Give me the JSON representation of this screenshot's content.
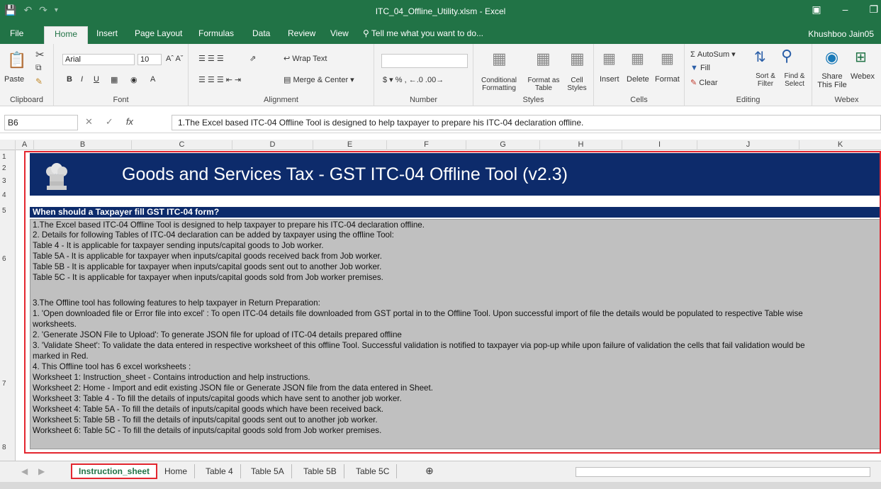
{
  "window": {
    "title": "ITC_04_Offline_Utility.xlsm - Excel",
    "user": "Khushboo Jain05",
    "qat_icons": [
      "save-icon",
      "undo-icon",
      "redo-icon",
      "customize-icon"
    ]
  },
  "ribbon_tabs": [
    "File",
    "Home",
    "Insert",
    "Page Layout",
    "Formulas",
    "Data",
    "Review",
    "View"
  ],
  "tell_me": "Tell me what you want to do...",
  "ribbon": {
    "clipboard": {
      "paste": "Paste",
      "label": "Clipboard"
    },
    "font": {
      "name": "Arial",
      "size": "10",
      "label": "Font"
    },
    "alignment": {
      "wrap": "Wrap Text",
      "merge": "Merge & Center",
      "label": "Alignment"
    },
    "number": {
      "format": "",
      "label": "Number"
    },
    "styles": {
      "conditional": "Conditional Formatting",
      "format_table": "Format as Table",
      "cell_styles": "Cell Styles",
      "label": "Styles"
    },
    "cells": {
      "insert": "Insert",
      "delete": "Delete",
      "format": "Format",
      "label": "Cells"
    },
    "editing": {
      "autosum": "AutoSum",
      "fill": "Fill",
      "clear": "Clear",
      "sort": "Sort & Filter",
      "find": "Find & Select",
      "label": "Editing"
    },
    "webex": {
      "share": "Share This File",
      "webex": "Webex",
      "label": "Webex"
    }
  },
  "formula_bar": {
    "cell_ref": "B6",
    "fx": "fx",
    "content": "1.The Excel based ITC-04 Offline Tool is designed to help taxpayer to prepare his ITC-04 declaration offline."
  },
  "columns": [
    "A",
    "B",
    "C",
    "D",
    "E",
    "F",
    "G",
    "H",
    "I",
    "J",
    "K"
  ],
  "rows": [
    "1",
    "2",
    "3",
    "4",
    "5",
    "6",
    "7",
    "8"
  ],
  "sheet": {
    "banner_title": "Goods and Services Tax - GST ITC-04 Offline Tool (v2.3)",
    "question": "When should a Taxpayer  fill GST ITC-04 form?",
    "lines": [
      "1.The Excel based ITC-04 Offline Tool is designed to help taxpayer to prepare his ITC-04 declaration offline.",
      "2. Details for following Tables of ITC-04 declaration can be added by taxpayer using the offline Tool:",
      "    Table 4 - It is applicable for taxpayer sending inputs/capital goods to Job worker.",
      "    Table 5A - It is applicable for taxpayer when inputs/capital goods received back from Job worker.",
      "    Table 5B - It is applicable for taxpayer when inputs/capital goods sent out to another Job worker.",
      "    Table 5C - It is applicable for taxpayer when inputs/capital goods sold from Job worker premises.",
      "",
      "3.The Offline tool has following features to help taxpayer in Return Preparation:",
      "     1. 'Open downloaded file or Error file into excel' : To open ITC-04 details file downloaded from GST portal in to the Offline Tool. Upon successful import of file the details would be populated to respective Table wise",
      "worksheets.",
      "     2. 'Generate JSON File to Upload': To generate JSON file for upload of ITC-04 details prepared offline",
      "     3. 'Validate Sheet': To validate the data entered in respective worksheet of this offline Tool. Successful validation is notified to taxpayer via pop-up while upon failure of validation the cells that fail validation would be",
      "marked in Red.",
      "4. This Offline tool has 6 excel worksheets :",
      "    Worksheet 1: Instruction_sheet - Contains introduction and help instructions.",
      "    Worksheet 2: Home - Import and edit existing JSON file or Generate JSON file from the data entered in Sheet.",
      "    Worksheet 3: Table 4 - To fill the details of inputs/capital goods which have sent to another job worker.",
      "    Worksheet 4: Table 5A - To fill the details of inputs/capital goods which have been received back.",
      "    Worksheet 5: Table 5B - To fill the details of inputs/capital goods sent out to another job worker.",
      "    Worksheet 6: Table 5C - To fill the details of inputs/capital goods sold from Job worker premises."
    ]
  },
  "sheet_tabs": [
    "Instruction_sheet",
    "Home",
    "Table 4",
    "Table 5A",
    "Table 5B",
    "Table 5C"
  ],
  "colors": {
    "excel_green": "#217346",
    "banner_navy": "#0d2b6b",
    "highlight_red": "#e3262f",
    "body_gray": "#c0c0c0"
  }
}
